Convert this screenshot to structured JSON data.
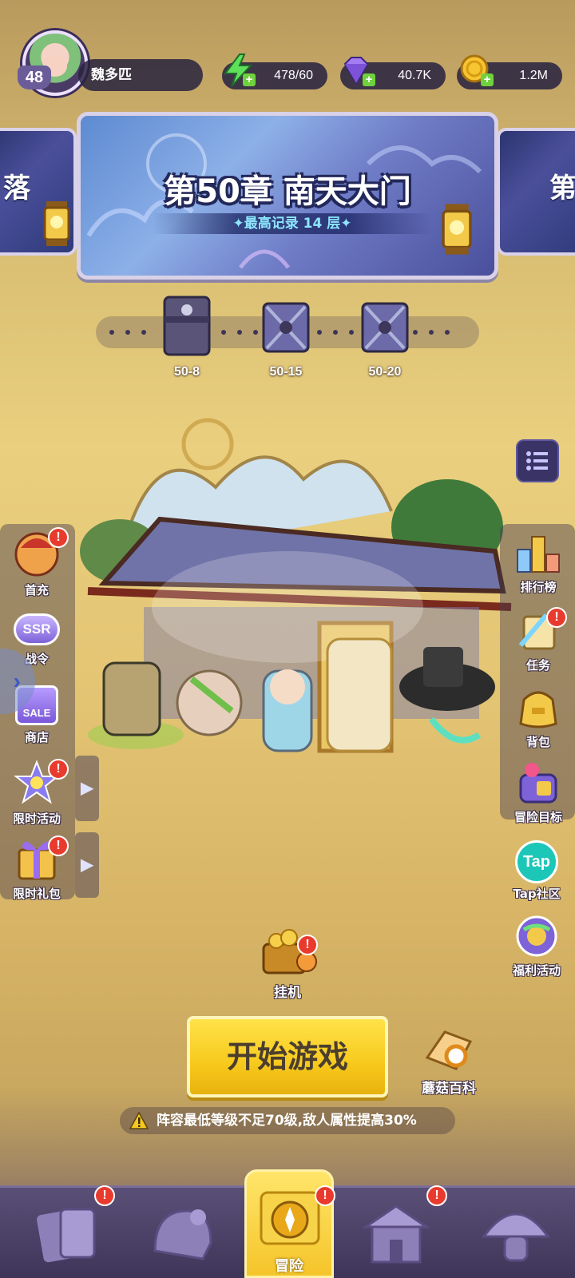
{
  "player": {
    "level": "48",
    "name": "魏多匹"
  },
  "resources": {
    "energy": "478/60",
    "gems": "40.7K",
    "gold": "1.2M",
    "plus": "+"
  },
  "chapter": {
    "prev_partial": "落",
    "next_partial": "第",
    "title": "第50章 南天大门",
    "record": "✦最高记录 14 层✦"
  },
  "stages": [
    {
      "label": "50-8"
    },
    {
      "label": "50-15"
    },
    {
      "label": "50-20"
    }
  ],
  "left_menu": [
    {
      "label": "首充",
      "alert": "!"
    },
    {
      "label": "战令",
      "badge": "SSR"
    },
    {
      "label": "商店",
      "badge": "SALE"
    },
    {
      "label": "限时活动",
      "alert": "!"
    },
    {
      "label": "限时礼包",
      "alert": "!"
    }
  ],
  "right_menu": [
    {
      "label": "排行榜"
    },
    {
      "label": "任务",
      "alert": "!"
    },
    {
      "label": "背包"
    },
    {
      "label": "冒险目标"
    },
    {
      "label": "Tap社区",
      "logo": "Tap"
    },
    {
      "label": "福利活动"
    }
  ],
  "idle": {
    "label": "挂机",
    "alert": "!"
  },
  "start_button": "开始游戏",
  "encyclopedia": "蘑菇百科",
  "warning": "阵容最低等级不足70级,敌人属性提高30%",
  "nav": {
    "center_label": "冒险",
    "alert": "!"
  },
  "colors": {
    "start_button": "#f7c91c",
    "alert": "#e83b2e",
    "nav_bg": "#4a3f66"
  }
}
